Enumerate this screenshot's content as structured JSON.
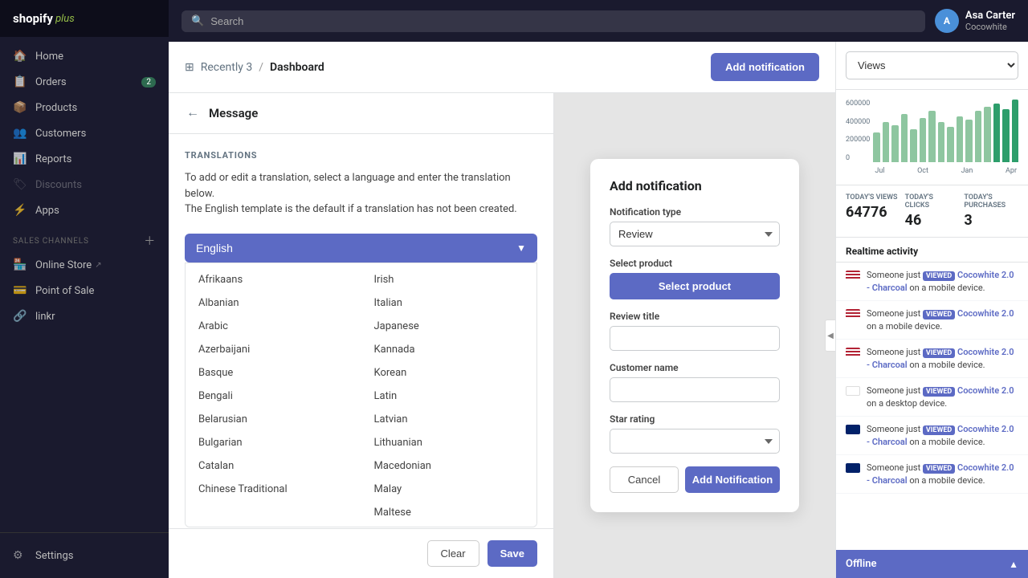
{
  "sidebar": {
    "logo": "shopify",
    "plus": "plus",
    "nav_items": [
      {
        "id": "home",
        "label": "Home",
        "icon": "🏠",
        "badge": null
      },
      {
        "id": "orders",
        "label": "Orders",
        "icon": "📋",
        "badge": "2"
      },
      {
        "id": "products",
        "label": "Products",
        "icon": "📦",
        "badge": null
      },
      {
        "id": "customers",
        "label": "Customers",
        "icon": "👥",
        "badge": null
      },
      {
        "id": "reports",
        "label": "Reports",
        "icon": "📊",
        "badge": null
      },
      {
        "id": "discounts",
        "label": "Discounts",
        "icon": "🏷",
        "badge": null
      },
      {
        "id": "apps",
        "label": "Apps",
        "icon": "⚡",
        "badge": null
      }
    ],
    "sales_channels_label": "SALES CHANNELS",
    "channels": [
      {
        "id": "online-store",
        "label": "Online Store",
        "icon": "🏪",
        "external": true
      },
      {
        "id": "point-of-sale",
        "label": "Point of Sale",
        "icon": "💳",
        "external": false
      },
      {
        "id": "linkr",
        "label": "linkr",
        "icon": "🔗",
        "external": false
      }
    ],
    "settings_label": "Settings"
  },
  "topbar": {
    "search_placeholder": "Search",
    "user_name": "Asa Carter",
    "user_store": "Cocowhite",
    "avatar_initials": "A"
  },
  "breadcrumb": {
    "parent": "Recently 3",
    "current": "Dashboard"
  },
  "add_notification_btn": "Add notification",
  "panel": {
    "back_label": "←",
    "title": "Message",
    "translations_heading": "TRANSLATIONS",
    "description_line1": "To add or edit a translation, select a language and enter the translation below.",
    "description_line2": "The English template is the default if a translation has not been created.",
    "selected_language": "English",
    "languages_col1": [
      "Afrikaans",
      "Albanian",
      "Arabic",
      "Azerbaijani",
      "Basque",
      "Bengali",
      "Belarusian",
      "Bulgarian",
      "Catalan",
      "Chinese Traditional"
    ],
    "languages_col2": [
      "Irish",
      "Italian",
      "Japanese",
      "Kannada",
      "Korean",
      "Latin",
      "Latvian",
      "Lithuanian",
      "Macedonian",
      "Malay",
      "Maltese"
    ],
    "clear_btn": "Clear",
    "save_btn": "Save"
  },
  "notification_modal": {
    "title": "Add notification",
    "notification_type_label": "Notification type",
    "notification_type_value": "Review",
    "select_product_label": "Select product",
    "select_product_btn": "Select product",
    "review_title_label": "Review title",
    "review_title_placeholder": "",
    "customer_name_label": "Customer name",
    "customer_name_placeholder": "",
    "star_rating_label": "Star rating",
    "star_rating_placeholder": "",
    "cancel_btn": "Cancel",
    "add_btn": "Add Notification"
  },
  "right_panel": {
    "views_label": "Views",
    "chart": {
      "y_labels": [
        "600000",
        "400000",
        "200000",
        "0"
      ],
      "x_labels": [
        "Jul",
        "Oct",
        "Jan",
        "Apr"
      ],
      "bars": [
        40,
        55,
        50,
        65,
        45,
        60,
        70,
        55,
        48,
        62,
        58,
        70,
        75,
        80,
        72,
        85
      ]
    },
    "stats": [
      {
        "label": "TODAY'S VIEWS",
        "value": "64776"
      },
      {
        "label": "TODAY'S CLICKS",
        "value": "46"
      },
      {
        "label": "TODAY'S PURCHASES",
        "value": "3"
      }
    ],
    "realtime_label": "Realtime activity",
    "activities": [
      {
        "flag": "us",
        "text": "Someone just",
        "badge": "VIEWED",
        "link": "Cocowhite 2.0 - Charcoal",
        "suffix": "on a mobile device."
      },
      {
        "flag": "us",
        "text": "Someone just",
        "badge": "VIEWED",
        "link": "Cocowhite 2.0",
        "suffix": "on a mobile device."
      },
      {
        "flag": "us",
        "text": "Someone just",
        "badge": "VIEWED",
        "link": "Cocowhite 2.0 - Charcoal",
        "suffix": "on a mobile device."
      },
      {
        "flag": "cy",
        "text": "Someone just",
        "badge": "VIEWED",
        "link": "Cocowhite 2.0",
        "suffix": "on a desktop device."
      },
      {
        "flag": "uk",
        "text": "Someone just",
        "badge": "VIEWED",
        "link": "Cocowhite 2.0 - Charcoal",
        "suffix": "on a mobile device."
      },
      {
        "flag": "uk",
        "text": "Someone just",
        "badge": "VIEWED",
        "link": "Cocowhite 2.0 - Charcoal",
        "suffix": "on a mobile device."
      }
    ],
    "offline_label": "Offline"
  }
}
